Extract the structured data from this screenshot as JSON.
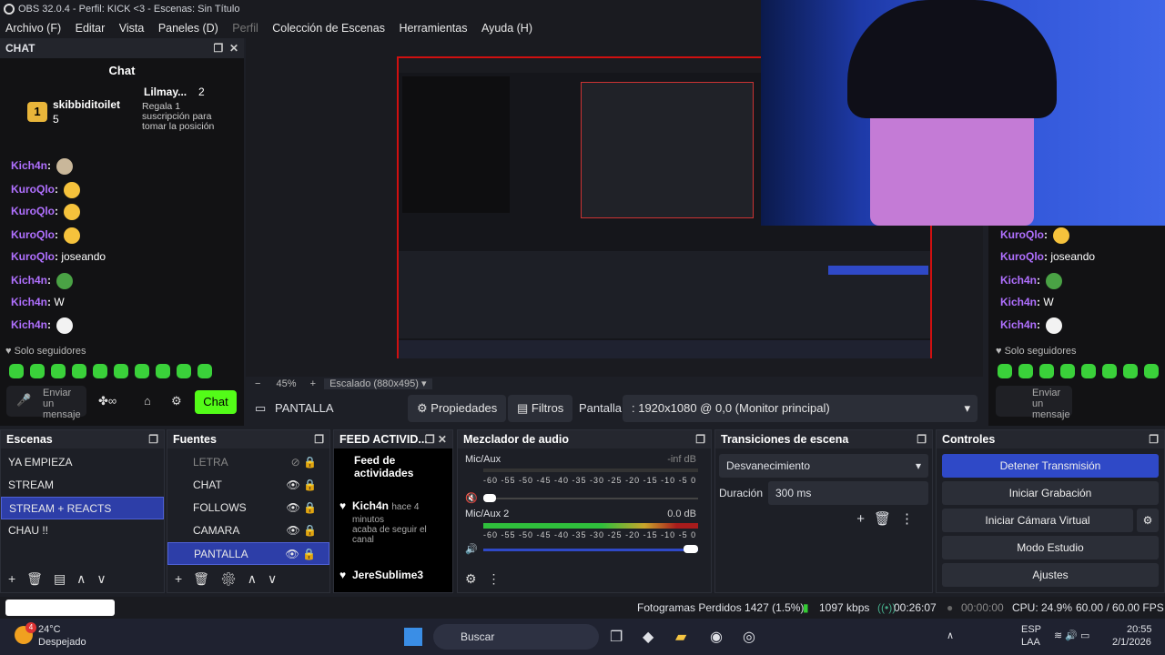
{
  "window": {
    "title": "OBS 32.0.4 - Perfil: KICK <3 - Escenas: Sin Título"
  },
  "menu": [
    "Archivo (F)",
    "Editar",
    "Vista",
    "Paneles (D)",
    "Perfil",
    "Colección de Escenas",
    "Herramientas",
    "Ayuda (H)"
  ],
  "chat": {
    "dock_title": "CHAT",
    "title": "Chat",
    "top_user": "skibbiditoilet",
    "top_user_rank": "1",
    "top_user_count": "5",
    "second_user": "Lilmay...",
    "second_count": "2",
    "gift_text": "Regala 1 suscripción para tomar la posición",
    "messages": [
      {
        "user": "Kich4n",
        "text": ""
      },
      {
        "user": "KuroQlo",
        "text": ""
      },
      {
        "user": "KuroQlo",
        "text": ""
      },
      {
        "user": "KuroQlo",
        "text": ""
      },
      {
        "user": "KuroQlo",
        "text": "joseando"
      },
      {
        "user": "Kich4n",
        "text": ""
      },
      {
        "user": "Kich4n",
        "text": "W"
      },
      {
        "user": "Kich4n",
        "text": ""
      }
    ],
    "followers_only": "Solo seguidores",
    "input_placeholder": "Enviar un mensaje",
    "send_button": "Chat"
  },
  "right_chat": {
    "messages": [
      {
        "user": "KuroQlo",
        "text": ""
      },
      {
        "user": "KuroQlo",
        "text": "joseando"
      },
      {
        "user": "Kich4n",
        "text": ""
      },
      {
        "user": "Kich4n",
        "text": "W"
      },
      {
        "user": "Kich4n",
        "text": ""
      }
    ],
    "followers_only": "Solo seguidores",
    "input_placeholder": "Enviar un mensaje"
  },
  "preview": {
    "zoom": "45%",
    "scaling": "Escalado (880x495)"
  },
  "source_toolbar": {
    "source": "PANTALLA",
    "properties": "Propiedades",
    "filters": "Filtros",
    "display_label": "Pantalla",
    "display_value": ": 1920x1080 @ 0,0 (Monitor principal)"
  },
  "scenes": {
    "title": "Escenas",
    "items": [
      "YA EMPIEZA",
      "STREAM",
      "STREAM + REACTS",
      "CHAU !!"
    ],
    "selected": 2
  },
  "sources": {
    "title": "Fuentes",
    "items": [
      "LETRA",
      "CHAT",
      "FOLLOWS",
      "CAMARA",
      "PANTALLA"
    ],
    "selected": 4
  },
  "feed": {
    "title": "FEED ACTIVID...",
    "header": "Feed de actividades",
    "events": [
      {
        "user": "Kich4n",
        "time": "hace 4 minutos",
        "text": "acaba de seguir el canal"
      },
      {
        "user": "JereSublime3",
        "time": "",
        "text": ""
      }
    ]
  },
  "mixer": {
    "title": "Mezclador de audio",
    "channels": [
      {
        "name": "Mic/Aux",
        "level": "-inf dB",
        "meter": 0
      },
      {
        "name": "Mic/Aux 2",
        "level": "0.0 dB",
        "meter": 0.75
      }
    ],
    "ticks": [
      "-60",
      "-55",
      "-50",
      "-45",
      "-40",
      "-35",
      "-30",
      "-25",
      "-20",
      "-15",
      "-10",
      "-5",
      "0"
    ]
  },
  "transitions": {
    "title": "Transiciones de escena",
    "type": "Desvanecimiento",
    "duration_label": "Duración",
    "duration": "300 ms"
  },
  "controls": {
    "title": "Controles",
    "buttons": [
      "Detener Transmisión",
      "Iniciar Grabación",
      "Iniciar Cámara Virtual",
      "Modo Estudio",
      "Ajustes"
    ]
  },
  "status": {
    "dropped": "Fotogramas Perdidos 1427 (1.5%)",
    "bitrate": "1097 kbps",
    "live_time": "00:26:07",
    "rec_time": "00:00:00",
    "cpu": "CPU: 24.9%",
    "fps": "60.00 / 60.00 FPS"
  },
  "taskbar": {
    "temp": "24°C",
    "weather": "Despejado",
    "badge": "4",
    "search": "Buscar",
    "lang1": "ESP",
    "lang2": "LAA",
    "time": "20:55",
    "date": "2/1/2026"
  },
  "colors": {
    "accent": "#2f49c7",
    "kick_green": "#53fc18",
    "username": "#b070ff"
  }
}
